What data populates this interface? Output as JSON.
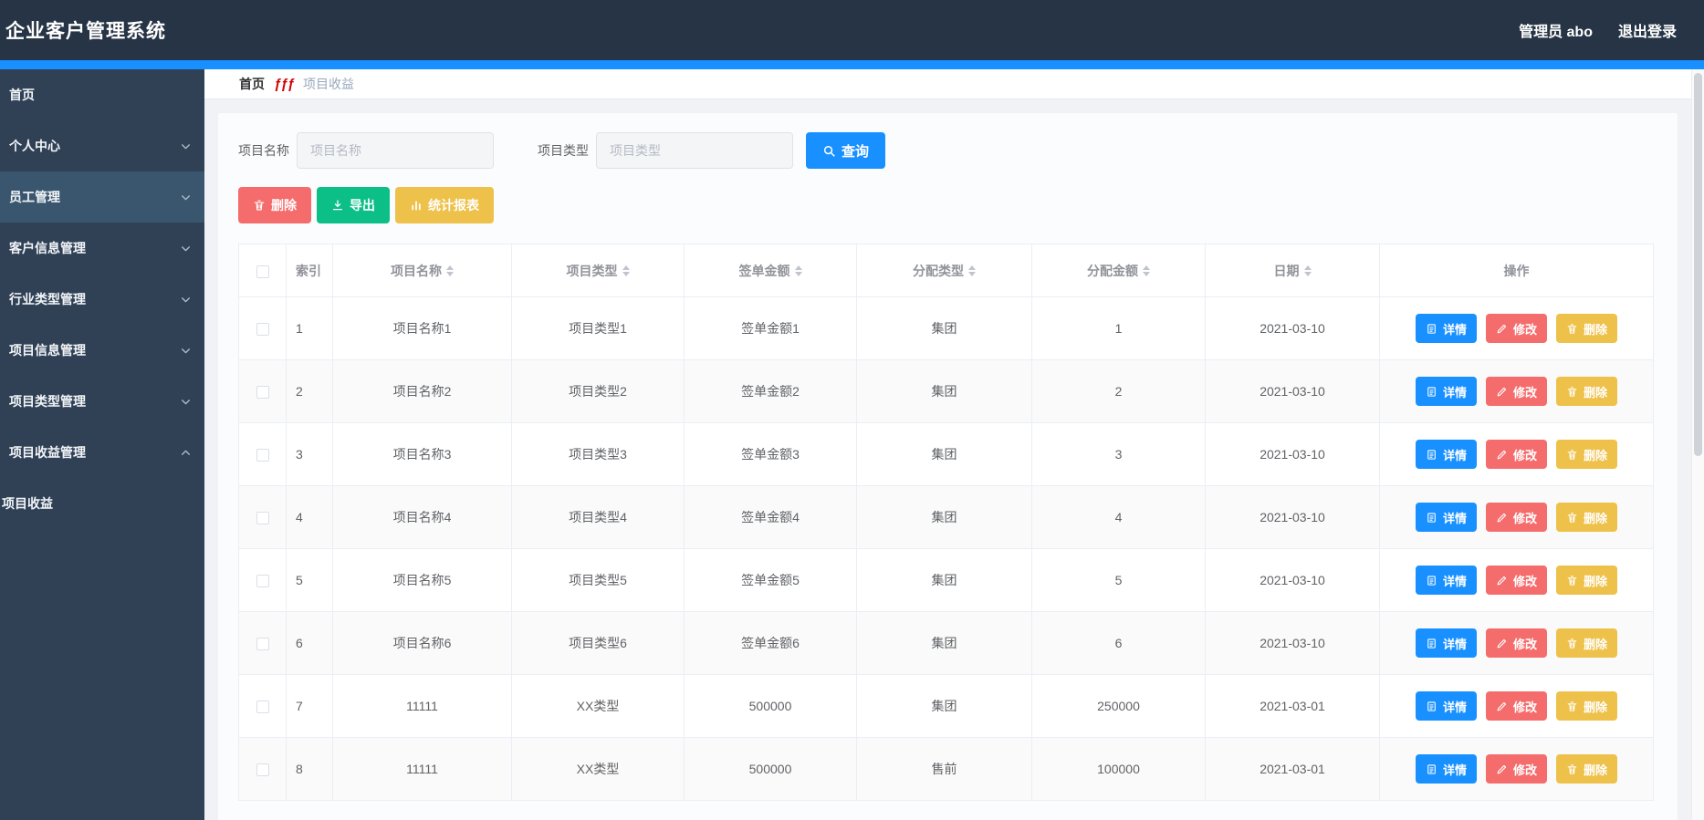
{
  "navbar": {
    "title": "企业客户管理系统",
    "user": "管理员 abo",
    "logout": "退出登录"
  },
  "sidebar": {
    "items": [
      {
        "label": "首页",
        "arrow": null,
        "active": false,
        "sub": false
      },
      {
        "label": "个人中心",
        "arrow": "down",
        "active": false,
        "sub": false
      },
      {
        "label": "员工管理",
        "arrow": "down",
        "active": true,
        "sub": false
      },
      {
        "label": "客户信息管理",
        "arrow": "down",
        "active": false,
        "sub": false
      },
      {
        "label": "行业类型管理",
        "arrow": "down",
        "active": false,
        "sub": false
      },
      {
        "label": "项目信息管理",
        "arrow": "down",
        "active": false,
        "sub": false
      },
      {
        "label": "项目类型管理",
        "arrow": "down",
        "active": false,
        "sub": false
      },
      {
        "label": "项目收益管理",
        "arrow": "up",
        "active": false,
        "sub": false
      },
      {
        "label": "项目收益",
        "arrow": null,
        "active": false,
        "sub": true
      }
    ]
  },
  "breadcrumb": {
    "home": "首页",
    "separator": "ƒƒƒ",
    "current": "项目收益"
  },
  "search": {
    "name_label": "项目名称",
    "name_placeholder": "项目名称",
    "name_value": "",
    "type_label": "项目类型",
    "type_placeholder": "项目类型",
    "type_value": "",
    "query_label": "查询",
    "query_icon": "search-icon"
  },
  "toolbar": {
    "buttons": [
      {
        "name": "delete-button",
        "label": "删除",
        "icon": "trash-icon",
        "color": "#f56c6c"
      },
      {
        "name": "export-button",
        "label": "导出",
        "icon": "download-icon",
        "color": "#0cbf87"
      },
      {
        "name": "report-button",
        "label": "统计报表",
        "icon": "bar-chart-icon",
        "color": "#eec14a"
      }
    ]
  },
  "table": {
    "columns": [
      {
        "label": "",
        "type": "checkbox",
        "sortable": false
      },
      {
        "label": "索引",
        "type": "index",
        "sortable": false
      },
      {
        "label": "项目名称",
        "type": "text",
        "sortable": true
      },
      {
        "label": "项目类型",
        "type": "text",
        "sortable": true
      },
      {
        "label": "签单金额",
        "type": "text",
        "sortable": true
      },
      {
        "label": "分配类型",
        "type": "text",
        "sortable": true
      },
      {
        "label": "分配金额",
        "type": "text",
        "sortable": true
      },
      {
        "label": "日期",
        "type": "text",
        "sortable": true
      },
      {
        "label": "操作",
        "type": "actions",
        "sortable": false
      }
    ],
    "rows": [
      {
        "index": "1",
        "name": "项目名称1",
        "type": "项目类型1",
        "amount": "签单金额1",
        "alloc_type": "集团",
        "alloc_amount": "1",
        "date": "2021-03-10"
      },
      {
        "index": "2",
        "name": "项目名称2",
        "type": "项目类型2",
        "amount": "签单金额2",
        "alloc_type": "集团",
        "alloc_amount": "2",
        "date": "2021-03-10"
      },
      {
        "index": "3",
        "name": "项目名称3",
        "type": "项目类型3",
        "amount": "签单金额3",
        "alloc_type": "集团",
        "alloc_amount": "3",
        "date": "2021-03-10"
      },
      {
        "index": "4",
        "name": "项目名称4",
        "type": "项目类型4",
        "amount": "签单金额4",
        "alloc_type": "集团",
        "alloc_amount": "4",
        "date": "2021-03-10"
      },
      {
        "index": "5",
        "name": "项目名称5",
        "type": "项目类型5",
        "amount": "签单金额5",
        "alloc_type": "集团",
        "alloc_amount": "5",
        "date": "2021-03-10"
      },
      {
        "index": "6",
        "name": "项目名称6",
        "type": "项目类型6",
        "amount": "签单金额6",
        "alloc_type": "集团",
        "alloc_amount": "6",
        "date": "2021-03-10"
      },
      {
        "index": "7",
        "name": "11111",
        "type": "XX类型",
        "amount": "500000",
        "alloc_type": "集团",
        "alloc_amount": "250000",
        "date": "2021-03-01"
      },
      {
        "index": "8",
        "name": "11111",
        "type": "XX类型",
        "amount": "500000",
        "alloc_type": "售前",
        "alloc_amount": "100000",
        "date": "2021-03-01"
      }
    ],
    "row_actions": [
      {
        "name": "detail-button",
        "label": "详情",
        "icon": "document-icon",
        "color": "#1890ff"
      },
      {
        "name": "edit-button",
        "label": "修改",
        "icon": "pen-icon",
        "color": "#f56c6c"
      },
      {
        "name": "row-delete-button",
        "label": "删除",
        "icon": "trash-icon",
        "color": "#eec14a"
      }
    ]
  },
  "colors": {
    "navbar_bg": "#263445",
    "sidebar_bg": "#304156",
    "sidebar_active_bg": "#3a566f",
    "accent_blue": "#1890ff",
    "danger_red": "#f56c6c",
    "success_green": "#0cbf87",
    "warning_yellow": "#eec14a",
    "breadcrumb_sep_red": "#d40000"
  }
}
